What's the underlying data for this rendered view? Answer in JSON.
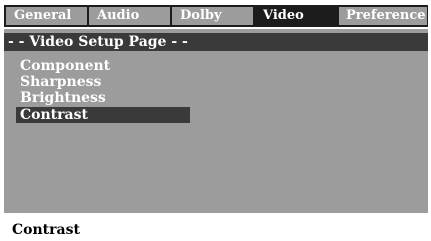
{
  "tabs": [
    {
      "label": "General"
    },
    {
      "label": "Audio"
    },
    {
      "label": "Dolby"
    },
    {
      "label": "Video"
    },
    {
      "label": "Preference"
    }
  ],
  "active_tab": "Video",
  "page_title": "- - Video Setup Page - -",
  "menu": {
    "items": [
      {
        "label": "Component"
      },
      {
        "label": "Sharpness"
      },
      {
        "label": "Brightness"
      },
      {
        "label": "Contrast"
      }
    ],
    "selected": "Contrast"
  },
  "footer": {
    "text": "Contrast"
  },
  "colors": {
    "tab_inactive": "#9c9c9c",
    "tab_active": "#1c1c1c",
    "panel_bg": "#9c9c9c",
    "highlight_bg": "#3a3a3a",
    "text_light": "#ffffff",
    "text_dark": "#000000"
  }
}
